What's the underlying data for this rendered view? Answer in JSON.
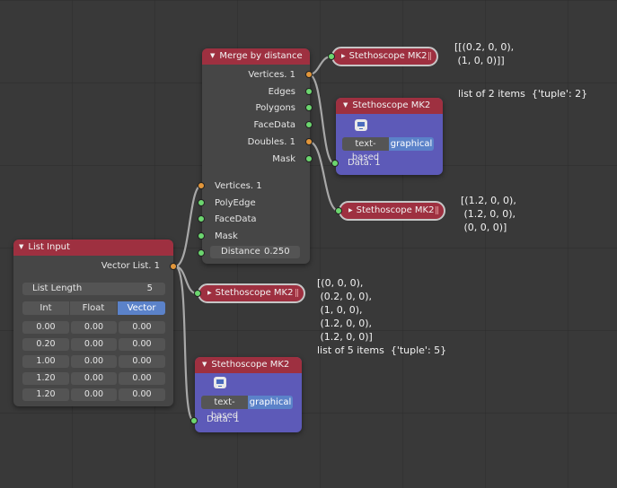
{
  "nodes": {
    "merge": {
      "title": "Merge by distance",
      "outputs": [
        "Vertices. 1",
        "Edges",
        "Polygons",
        "FaceData",
        "Doubles. 1",
        "Mask"
      ],
      "inputs": [
        "Vertices. 1",
        "PolyEdge",
        "FaceData",
        "Mask"
      ],
      "distance_label": "Distance",
      "distance_value": "0.250"
    },
    "list_input": {
      "title": "List Input",
      "output": "Vector List. 1",
      "length_label": "List Length",
      "length_value": "5",
      "modes": [
        "Int",
        "Float",
        "Vector"
      ],
      "active_mode": "Vector",
      "rows": [
        [
          "0.00",
          "0.00",
          "0.00"
        ],
        [
          "0.20",
          "0.00",
          "0.00"
        ],
        [
          "1.00",
          "0.00",
          "0.00"
        ],
        [
          "1.20",
          "0.00",
          "0.00"
        ],
        [
          "1.20",
          "0.00",
          "0.00"
        ]
      ]
    },
    "stetho_vertices": {
      "title": "Stethoscope MK2",
      "output_text": "[[(0.2, 0, 0),\n (1, 0, 0)]]"
    },
    "stetho_info": {
      "title": "Stethoscope MK2",
      "btn_text": "text-based",
      "btn_graph": "graphical",
      "input": "Data. 1",
      "output_text": "list of 2 items  {'tuple': 2}"
    },
    "stetho_doubles": {
      "title": "Stethoscope MK2",
      "output_text": "[(1.2, 0, 0),\n (1.2, 0, 0),\n (0, 0, 0)]"
    },
    "stetho_list": {
      "title": "Stethoscope MK2",
      "output_text": "[(0, 0, 0),\n (0.2, 0, 0),\n (1, 0, 0),\n (1.2, 0, 0),\n (1.2, 0, 0)]\nlist of 5 items  {'tuple': 5}"
    },
    "stetho_bottom": {
      "title": "Stethoscope MK2",
      "btn_text": "text-based",
      "btn_graph": "graphical",
      "input": "Data. 1"
    }
  },
  "colors": {
    "background": "#393939",
    "header": "#9e3040",
    "node_body": "#464646",
    "node_body_blue": "#5d5ab8",
    "socket_green": "#6cd66f",
    "socket_orange": "#e2963a",
    "active_button": "#5b82c9"
  },
  "icons": {
    "collapse": "▼",
    "expand": "▶",
    "pause": "||",
    "monitor": "monitor-icon"
  }
}
